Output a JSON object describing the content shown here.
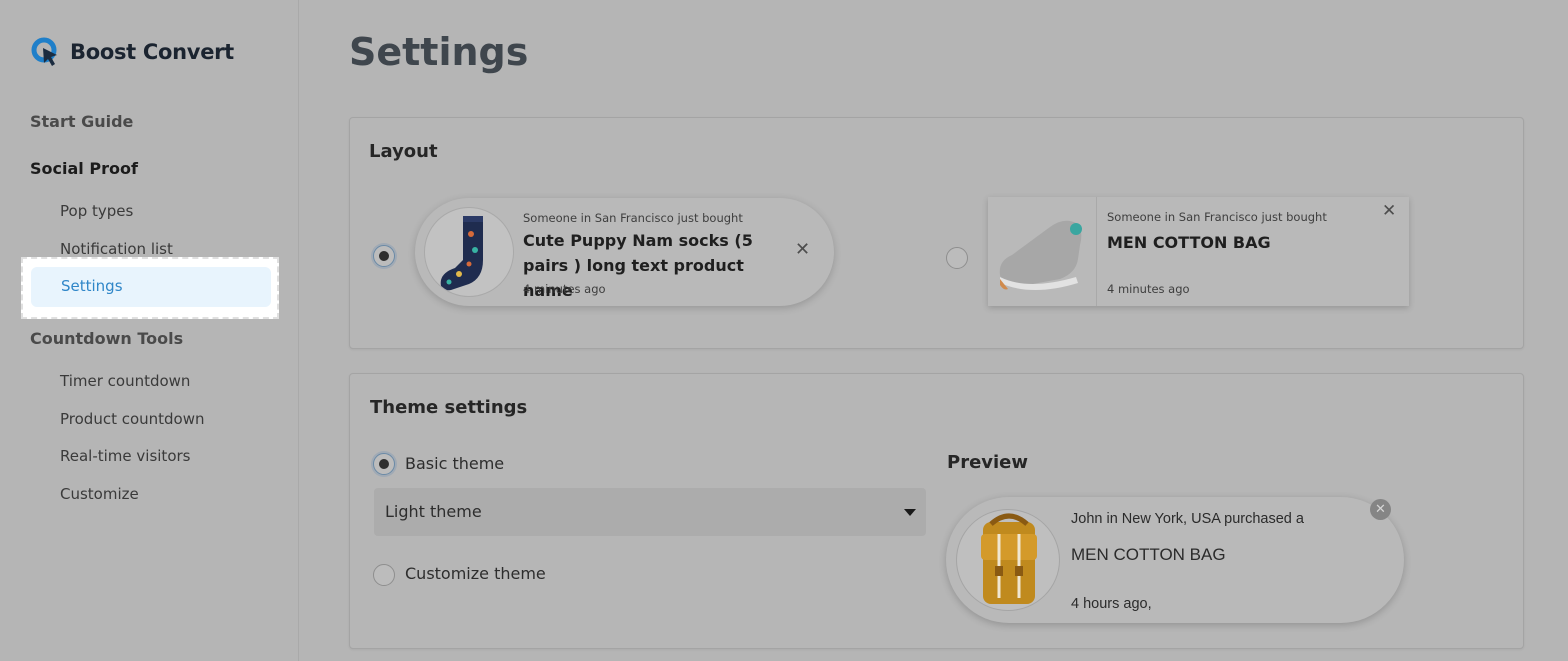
{
  "app": {
    "name": "Boost Convert"
  },
  "sidebar": {
    "sections": [
      {
        "label": "Start Guide"
      },
      {
        "label": "Social Proof"
      },
      {
        "label": "Countdown Tools"
      }
    ],
    "social_proof_items": [
      "Pop types",
      "Notification list",
      "Settings"
    ],
    "countdown_items": [
      "Timer countdown",
      "Product countdown",
      "Real-time visitors",
      "Customize"
    ],
    "active_item": "Settings"
  },
  "page": {
    "title": "Settings"
  },
  "layout_card": {
    "title": "Layout",
    "options": [
      {
        "selected": true,
        "meta": "Someone in San Francisco just bought",
        "product": "Cute Puppy Nam socks (5 pairs ) long text product name",
        "time": "4 minutes ago",
        "close": "✕"
      },
      {
        "selected": false,
        "meta": "Someone in San Francisco just bought",
        "product": "MEN COTTON BAG",
        "time": "4 minutes ago",
        "close": "✕"
      }
    ]
  },
  "theme_card": {
    "title": "Theme settings",
    "basic_theme_label": "Basic theme",
    "basic_theme_selected": true,
    "select_value": "Light theme",
    "customize_theme_label": "Customize theme",
    "customize_theme_selected": false,
    "preview": {
      "title": "Preview",
      "line1": "John in New York, USA purchased a",
      "product": "MEN COTTON BAG",
      "time": "4 hours ago,",
      "close": "✕"
    }
  },
  "colors": {
    "accent": "#2f86c8",
    "active_bg": "#e8f4fd",
    "overlay_bg": "#b5b5b5"
  },
  "icons": [
    "logo-cursor-icon",
    "close-icon",
    "chevron-down-icon"
  ]
}
